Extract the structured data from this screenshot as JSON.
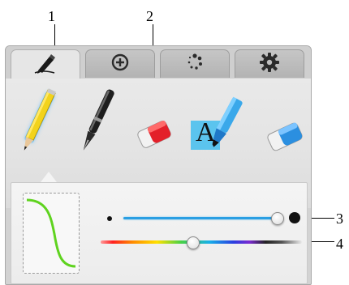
{
  "callouts": {
    "c1": "1",
    "c2": "2",
    "c3": "3",
    "c4": "4"
  },
  "tabs": [
    {
      "icon": "pen-icon",
      "active": true
    },
    {
      "icon": "plus-circle-icon",
      "active": false
    },
    {
      "icon": "dots-spinner-icon",
      "active": false
    },
    {
      "icon": "gear-icon",
      "active": false
    }
  ],
  "tools": [
    {
      "name": "pencil",
      "selected": true
    },
    {
      "name": "pen",
      "selected": false
    },
    {
      "name": "red-eraser",
      "selected": false
    },
    {
      "name": "text-highlighter",
      "selected": false
    },
    {
      "name": "blue-eraser",
      "selected": false
    }
  ],
  "text_tool": {
    "letter": "A"
  },
  "settings": {
    "size_level": 0.95,
    "color_position": 0.43,
    "size_track_color": "#2a9fe3",
    "curve_color": "#5fd31f"
  },
  "colors": {
    "selection_glow": "#3fb4ff",
    "highlight_bg": "#5bc4ee"
  }
}
